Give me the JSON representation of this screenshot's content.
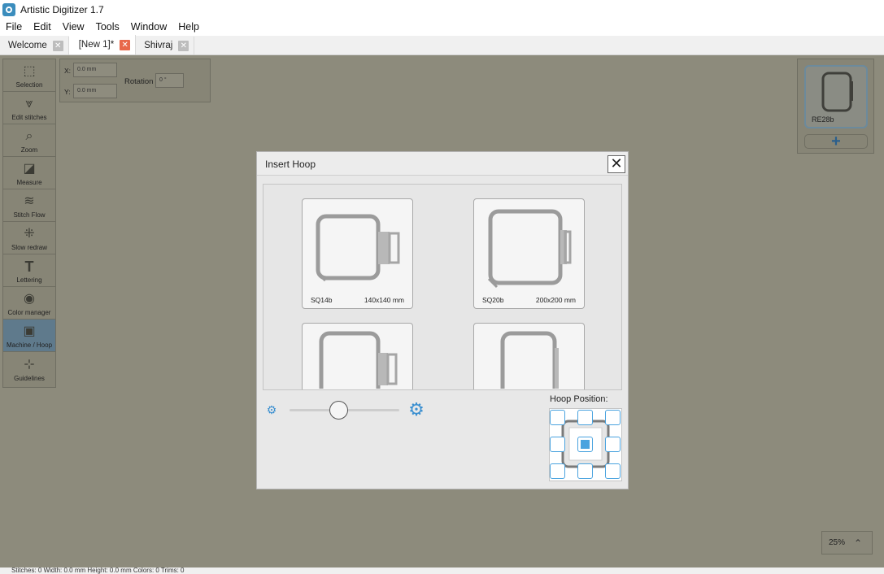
{
  "app": {
    "title": "Artistic Digitizer 1.7"
  },
  "menu": [
    "File",
    "Edit",
    "View",
    "Tools",
    "Window",
    "Help"
  ],
  "tabs": [
    {
      "label": "Welcome",
      "close": "✕"
    },
    {
      "label": "[New 1]*",
      "close": "✕",
      "active": true
    },
    {
      "label": "Shivraj",
      "close": "✕"
    }
  ],
  "toolbox": [
    {
      "label": "Selection",
      "icon": "selection-icon",
      "glyph": "⬚"
    },
    {
      "label": "Edit stitches",
      "icon": "edit-stitches-icon",
      "glyph": "⩔"
    },
    {
      "label": "Zoom",
      "icon": "zoom-icon",
      "glyph": "⌕"
    },
    {
      "label": "Measure",
      "icon": "measure-icon",
      "glyph": "◪"
    },
    {
      "label": "Stitch Flow",
      "icon": "stitch-flow-icon",
      "glyph": "≋"
    },
    {
      "label": "Slow redraw",
      "icon": "slow-redraw-icon",
      "glyph": "⁜"
    },
    {
      "label": "Lettering",
      "icon": "lettering-icon",
      "glyph": "T"
    },
    {
      "label": "Color manager",
      "icon": "palette-icon",
      "glyph": "◉"
    },
    {
      "label": "Machine / Hoop",
      "icon": "hoop-icon",
      "glyph": "▣",
      "active": true
    },
    {
      "label": "Guidelines",
      "icon": "guidelines-icon",
      "glyph": "⊹"
    }
  ],
  "props": {
    "x_label": "X:",
    "x_value": "0.0 mm",
    "y_label": "Y:",
    "y_value": "0.0 mm",
    "rotation_label": "Rotation",
    "rotation_value": "0 °"
  },
  "machine": {
    "name": "RE28b",
    "add_label": "+"
  },
  "zoom": {
    "value": "25%",
    "chevron": "⌃"
  },
  "status": {
    "text": "Stitches: 0    Width: 0.0 mm    Height: 0.0 mm    Colors: 0    Trims: 0"
  },
  "dialog": {
    "title": "Insert Hoop",
    "close": "✕",
    "hoops": [
      {
        "name": "SQ14b",
        "size": "140x140 mm"
      },
      {
        "name": "SQ20b",
        "size": "200x200 mm"
      },
      {
        "name": "",
        "size": ""
      },
      {
        "name": "",
        "size": ""
      }
    ],
    "slider": {
      "small_icon": "⚙",
      "big_icon": "⚙",
      "level": 0.45
    },
    "hoop_position_label": "Hoop Position:"
  }
}
